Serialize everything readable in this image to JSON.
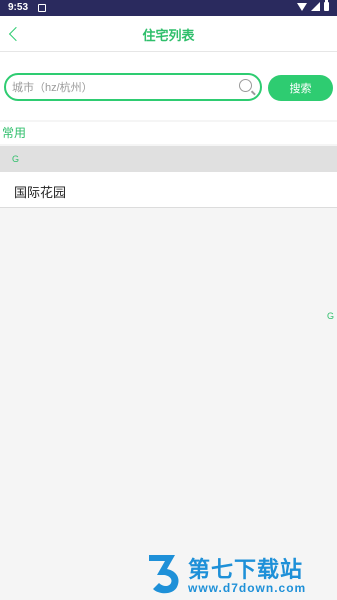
{
  "status_bar": {
    "time": "9:53"
  },
  "header": {
    "title": "住宅列表"
  },
  "search": {
    "placeholder": "城市（hz/杭州）",
    "value": "",
    "button_label": "搜索"
  },
  "section": {
    "label": "常用"
  },
  "groups": [
    {
      "letter": "G",
      "items": [
        {
          "label": "国际花园"
        }
      ]
    }
  ],
  "index_bar": {
    "letters": [
      "G"
    ]
  },
  "watermark": {
    "title": "第七下载站",
    "url": "www.d7down.com"
  },
  "colors": {
    "accent": "#2ecc71",
    "status_bar": "#2a2a5e",
    "watermark": "#1e90d8"
  }
}
